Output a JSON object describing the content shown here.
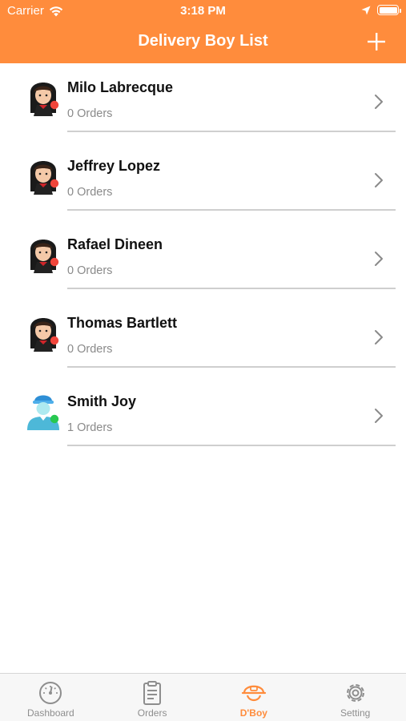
{
  "status_bar": {
    "carrier": "Carrier",
    "time": "3:18 PM"
  },
  "header": {
    "title": "Delivery Boy List",
    "add_icon": "plus-icon"
  },
  "colors": {
    "brand": "#FF8C3C",
    "offline": "#F0463C",
    "online": "#28C850"
  },
  "delivery_boys": [
    {
      "name": "Milo Labrecque",
      "orders": "0 Orders",
      "status": "offline",
      "avatar": "boy-avatar"
    },
    {
      "name": "Jeffrey Lopez",
      "orders": "0 Orders",
      "status": "offline",
      "avatar": "boy-avatar"
    },
    {
      "name": "Rafael Dineen",
      "orders": "0 Orders",
      "status": "offline",
      "avatar": "boy-avatar"
    },
    {
      "name": "Thomas Bartlett",
      "orders": "0 Orders",
      "status": "offline",
      "avatar": "boy-avatar"
    },
    {
      "name": "Smith Joy",
      "orders": "1 Orders",
      "status": "online",
      "avatar": "courier-avatar"
    }
  ],
  "tabs": [
    {
      "label": "Dashboard",
      "icon": "dashboard-gauge-icon",
      "active": false
    },
    {
      "label": "Orders",
      "icon": "clipboard-icon",
      "active": false
    },
    {
      "label": "D'Boy",
      "icon": "delivery-helmet-icon",
      "active": true
    },
    {
      "label": "Setting",
      "icon": "gear-icon",
      "active": false
    }
  ]
}
